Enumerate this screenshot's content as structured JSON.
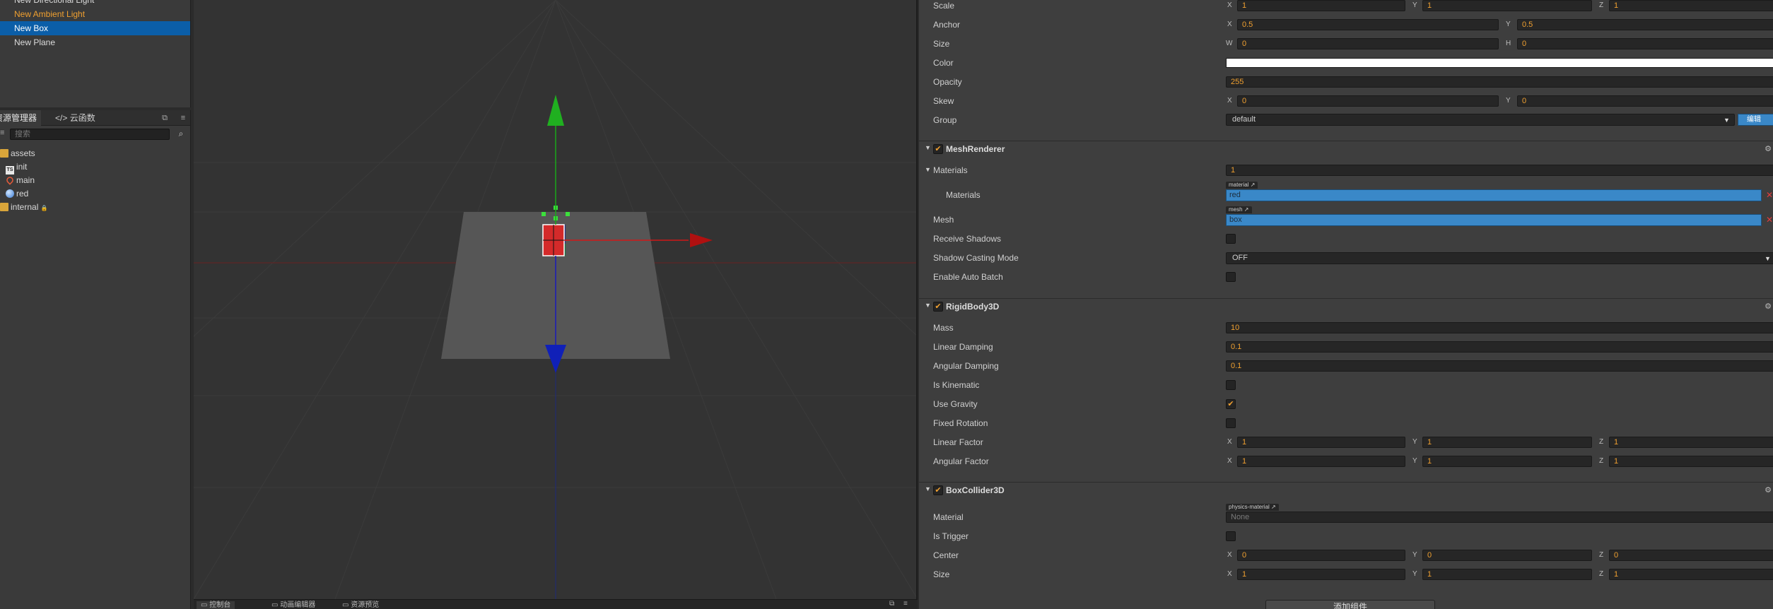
{
  "hierarchy": {
    "items": [
      {
        "label": "New Directional Light"
      },
      {
        "label": "New Ambient Light"
      },
      {
        "label": "New Box"
      },
      {
        "label": "New Plane"
      }
    ]
  },
  "assets_panel": {
    "tabs": [
      {
        "label": "资源管理器"
      },
      {
        "label": "云函数"
      }
    ],
    "search_placeholder": "搜索",
    "items": [
      {
        "label": "assets",
        "icon": "folder-icon"
      },
      {
        "label": "init",
        "icon": "typescript-file-icon",
        "badge": "TS"
      },
      {
        "label": "main",
        "icon": "scene-file-icon"
      },
      {
        "label": "red",
        "icon": "material-sphere-icon"
      },
      {
        "label": "internal",
        "icon": "folder-icon",
        "lock": "🔒"
      }
    ]
  },
  "bottom_tabs": [
    {
      "label": "控制台"
    },
    {
      "label": "动画编辑器"
    },
    {
      "label": "资源预览"
    }
  ],
  "inspector": {
    "node": {
      "scale": {
        "label": "Scale",
        "x": "1",
        "y": "1",
        "z": "1"
      },
      "anchor": {
        "label": "Anchor",
        "x": "0.5",
        "y": "0.5"
      },
      "size": {
        "label": "Size",
        "w": "0",
        "h": "0"
      },
      "color": {
        "label": "Color",
        "value": "#ffffff"
      },
      "opacity": {
        "label": "Opacity",
        "value": "255"
      },
      "skew": {
        "label": "Skew",
        "x": "0",
        "y": "0"
      },
      "group": {
        "label": "Group",
        "value": "default",
        "edit_label": "编辑"
      }
    },
    "mesh_renderer": {
      "title": "MeshRenderer",
      "materials_label": "Materials",
      "materials_count": "1",
      "materials_item_label": "Materials",
      "material_tag": "material",
      "material_value": "red",
      "mesh_label": "Mesh",
      "mesh_tag": "mesh",
      "mesh_value": "box",
      "receive_shadows": {
        "label": "Receive Shadows",
        "checked": false
      },
      "shadow_casting": {
        "label": "Shadow Casting Mode",
        "value": "OFF"
      },
      "auto_batch": {
        "label": "Enable Auto Batch",
        "checked": false
      }
    },
    "rigidbody": {
      "title": "RigidBody3D",
      "mass": {
        "label": "Mass",
        "value": "10"
      },
      "linear_damping": {
        "label": "Linear Damping",
        "value": "0.1"
      },
      "angular_damping": {
        "label": "Angular Damping",
        "value": "0.1"
      },
      "is_kinematic": {
        "label": "Is Kinematic",
        "checked": false
      },
      "use_gravity": {
        "label": "Use Gravity",
        "checked": true
      },
      "fixed_rotation": {
        "label": "Fixed Rotation",
        "checked": false
      },
      "linear_factor": {
        "label": "Linear Factor",
        "x": "1",
        "y": "1",
        "z": "1"
      },
      "angular_factor": {
        "label": "Angular Factor",
        "x": "1",
        "y": "1",
        "z": "1"
      }
    },
    "box_collider": {
      "title": "BoxCollider3D",
      "material": {
        "label": "Material",
        "tag": "physics-material",
        "value": "None"
      },
      "is_trigger": {
        "label": "Is Trigger",
        "checked": false
      },
      "center": {
        "label": "Center",
        "x": "0",
        "y": "0",
        "z": "0"
      },
      "size": {
        "label": "Size",
        "x": "1",
        "y": "1",
        "z": "1"
      }
    },
    "add_component_label": "添加组件",
    "axis": {
      "x": "X",
      "y": "Y",
      "z": "Z",
      "w": "W",
      "h": "H"
    }
  },
  "colors": {
    "selection": "#0b5ea8",
    "orange_value": "#f0a030",
    "asset_ref": "#3a88c8",
    "gizmo_x": "#d01818",
    "gizmo_y": "#1aa81a",
    "gizmo_z": "#1a1ab8"
  }
}
